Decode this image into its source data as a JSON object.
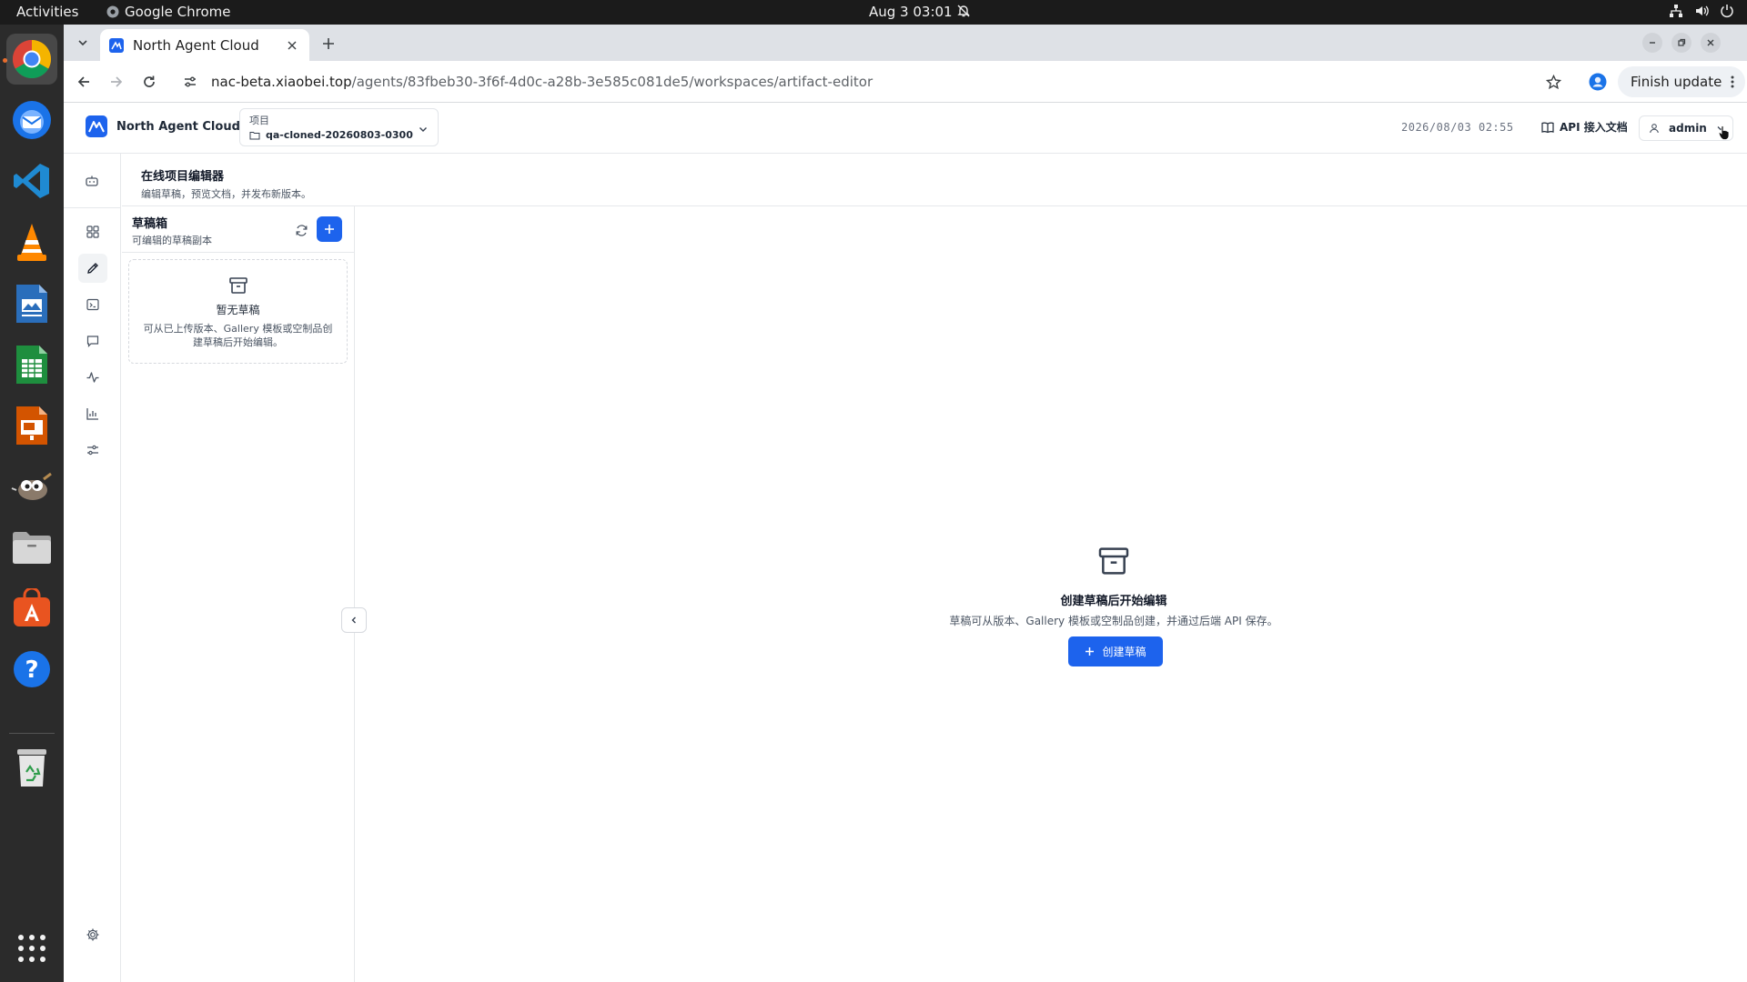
{
  "system": {
    "activities": "Activities",
    "app_name": "Google Chrome",
    "clock": "Aug 3  03:01"
  },
  "dock": {
    "items": [
      "chrome-icon",
      "thunderbird-icon",
      "vscode-icon",
      "vlc-icon",
      "writer-icon",
      "calc-icon",
      "impress-icon",
      "gimp-icon",
      "files-icon",
      "app-center-icon",
      "help-icon",
      "trash-icon",
      "apps-grid-icon"
    ]
  },
  "browser": {
    "tab_title": "North Agent Cloud",
    "url_host": "nac-beta.xiaobei.top",
    "url_path": "/agents/83fbeb30-3f6f-4d0c-a28b-3e585c081de5/workspaces/artifact-editor",
    "finish_update": "Finish update"
  },
  "header": {
    "brand": "North Agent Cloud",
    "project_label": "项目",
    "project_name": "qa-cloned-20260803-0300",
    "datetime": "2026/08/03 02:55",
    "api_docs": "API 接入文档",
    "user": "admin"
  },
  "page": {
    "title": "在线项目编辑器",
    "subtitle": "编辑草稿，预览文档，并发布新版本。"
  },
  "drafts": {
    "title": "草稿箱",
    "subtitle": "可编辑的草稿副本",
    "empty_title": "暂无草稿",
    "empty_desc": "可从已上传版本、Gallery 模板或空制品创建草稿后开始编辑。"
  },
  "main": {
    "empty_title": "创建草稿后开始编辑",
    "empty_desc": "草稿可从版本、Gallery 模板或空制品创建，并通过后端 API 保存。",
    "create_button": "创建草稿"
  },
  "colors": {
    "primary": "#1d63ed",
    "border": "#e6e8eb",
    "dock_bg": "#2b2b2b",
    "topbar_bg": "#1b1b1b"
  }
}
